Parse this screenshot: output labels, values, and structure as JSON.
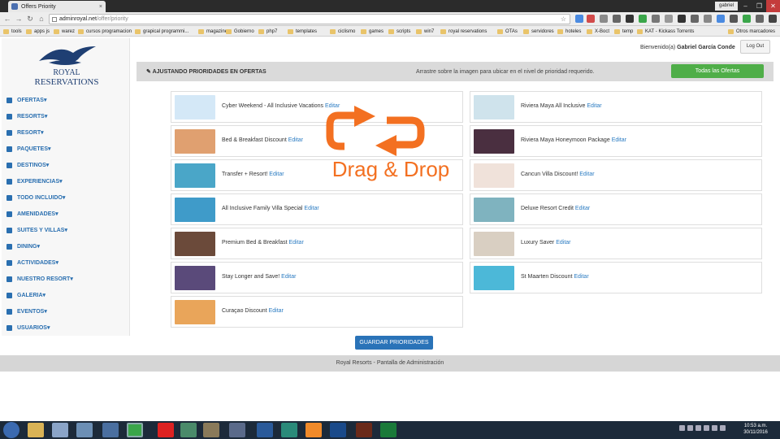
{
  "browser": {
    "tab_title": "Offers Priority",
    "tab_close": "×",
    "window_user": "gabriel",
    "back": "←",
    "forward": "→",
    "reload": "↻",
    "home": "⌂",
    "url_host": "adminroyal.net",
    "url_path": "/offer/priority",
    "star": "☆",
    "min": "–",
    "max": "❐",
    "close": "✕",
    "bookmarks": [
      "tools",
      "apps js",
      "warez",
      "cursos programacion",
      "grapical programmi...",
      "magazines",
      "Gobierno",
      "php7",
      "templates",
      "ciclismo",
      "games",
      "scripts",
      "win7",
      "royal reservations",
      "OTAs",
      "servidores",
      "hoteles",
      "X-Boct",
      "temp",
      "KAT - Kickass Torrents",
      "Otros marcadores"
    ]
  },
  "logo": {
    "line1": "ROYAL",
    "line2": "RESERVATIONS"
  },
  "menu": [
    {
      "label": "OFERTAS",
      "icon": "tag-icon"
    },
    {
      "label": "RESORTS",
      "icon": "home-icon"
    },
    {
      "label": "RESORT",
      "icon": "star-icon"
    },
    {
      "label": "PAQUETES",
      "icon": "list-icon"
    },
    {
      "label": "DESTINOS",
      "icon": "plane-icon"
    },
    {
      "label": "EXPERIENCIAS",
      "icon": "camera-icon"
    },
    {
      "label": "TODO INCLUIDO",
      "icon": "glass-icon"
    },
    {
      "label": "AMENIDADES",
      "icon": "grid-icon"
    },
    {
      "label": "SUITES Y VILLAS",
      "icon": "bed-icon"
    },
    {
      "label": "DINING",
      "icon": "fork-knife-icon"
    },
    {
      "label": "ACTIVIDADES",
      "icon": "check-icon"
    },
    {
      "label": "NUESTRO RESORT",
      "icon": "info-icon"
    },
    {
      "label": "GALERIA",
      "icon": "image-icon"
    },
    {
      "label": "EVENTOS",
      "icon": "phone-icon"
    },
    {
      "label": "USUARIOS",
      "icon": "user-icon"
    }
  ],
  "menu_caret": "▾",
  "user": {
    "greeting": "Bienvenido(a)",
    "name": "Gabriel García Conde",
    "logout": "Log Out"
  },
  "header": {
    "title": "AJUSTANDO PRIORIDADES EN OFERTAS",
    "hint": "Arrastre sobre la imagen para ubicar en el nivel de prioridad requerido.",
    "all_offers": "Todas las Ofertas"
  },
  "edit_label": "Editar",
  "offers_left": [
    {
      "name": "Cyber Weekend - All Inclusive Vacations",
      "color": "#d4e8f7"
    },
    {
      "name": "Bed & Breakfast Discount",
      "color": "#e0a070"
    },
    {
      "name": "Transfer + Resort!",
      "color": "#4aa6c8"
    },
    {
      "name": "All Inclusive Family Villa Special",
      "color": "#3f9bc9"
    },
    {
      "name": "Premium Bed & Breakfast",
      "color": "#6b4a3a"
    },
    {
      "name": "Stay Longer and Save!",
      "color": "#5a4a7a"
    },
    {
      "name": "Curaçao Discount",
      "color": "#e9a55a"
    }
  ],
  "offers_right": [
    {
      "name": "Riviera Maya All Inclusive",
      "color": "#cfe3ec"
    },
    {
      "name": "Riviera Maya Honeymoon Package",
      "color": "#4a2f40"
    },
    {
      "name": "Cancun Villa Discount!",
      "color": "#f0e2da"
    },
    {
      "name": "Deluxe Resort Credit",
      "color": "#7fb3bf"
    },
    {
      "name": "Luxury Saver",
      "color": "#d9cfc2"
    },
    {
      "name": "St Maarten Discount",
      "color": "#4cb8d8"
    }
  ],
  "drag_drop_label": "Drag & Drop",
  "accent_orange": "#f37021",
  "save_button": "GUARDAR PRIORIDADES",
  "footer": "Royal Resorts - Pantalla de Administración",
  "taskbar": {
    "time": "10:53 a.m.",
    "date": "30/11/2016"
  }
}
